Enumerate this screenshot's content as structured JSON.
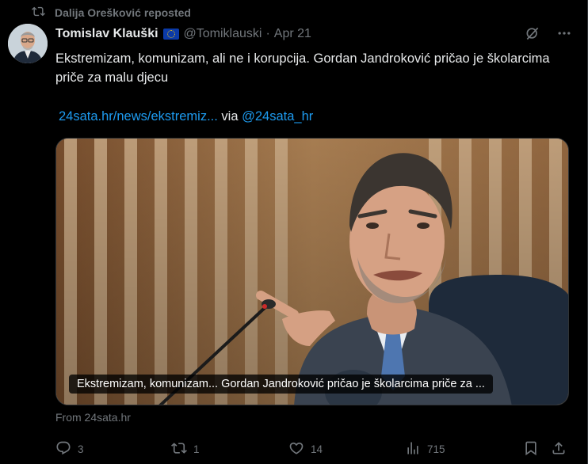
{
  "repost": {
    "label": "Dalija Orešković reposted",
    "icon": "repost-icon"
  },
  "author": {
    "name": "Tomislav Klauški",
    "badge": "eu-flag-icon",
    "handle": "@Tomiklauski",
    "separator": "·",
    "date": "Apr 21"
  },
  "tweet": {
    "text": "Ekstremizam, komunizam, ali ne i korupcija. Gordan Jandroković pričao je školarcima priče za malu djecu",
    "link": "24sata.hr/news/ekstremiz...",
    "via_label": "via",
    "via_handle": "@24sata_hr"
  },
  "card": {
    "caption": "Ekstremizam, komunizam... Gordan Jandroković pričao je školarcima priče za ...",
    "source": "From 24sata.hr"
  },
  "actions": {
    "replies": "3",
    "reposts": "1",
    "likes": "14",
    "views": "715"
  },
  "colors": {
    "background": "#000000",
    "text": "#e7e9ea",
    "muted": "#71767b",
    "link": "#1d9bf0"
  }
}
